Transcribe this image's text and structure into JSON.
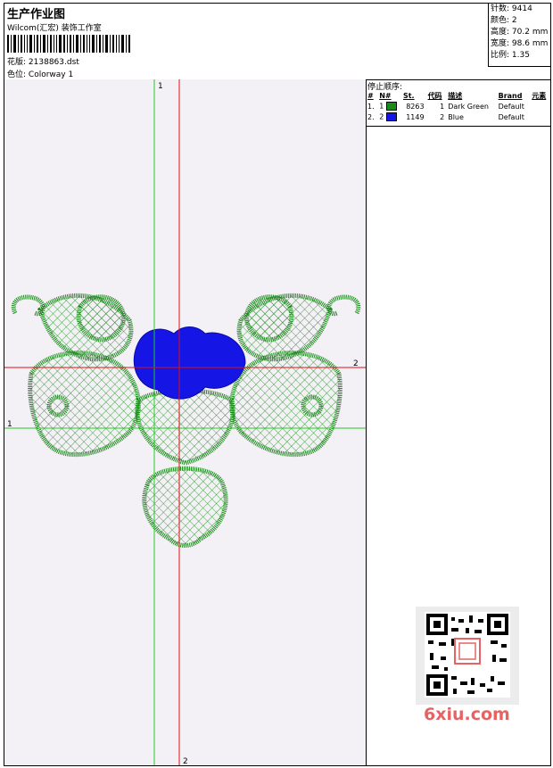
{
  "header": {
    "title": "生产作业图",
    "company": "Wilcom(汇宏) 装饰工作室",
    "pattern_label": "花版:",
    "pattern_value": "2138863.dst",
    "colorway_label": "色位:",
    "colorway_value": "Colorway 1"
  },
  "stats": {
    "stitches_label": "针数:",
    "stitches_value": "9414",
    "colors_label": "颜色:",
    "colors_value": "2",
    "height_label": "高度:",
    "height_value": "70.2 mm",
    "width_label": "宽度:",
    "width_value": "98.6 mm",
    "scale_label": "比例:",
    "scale_value": "1.35"
  },
  "stop_sequence": {
    "title": "停止顺序:",
    "headers": [
      "#",
      "N#",
      "St.",
      "代码",
      "描述",
      "Brand",
      "元素"
    ],
    "rows": [
      {
        "index": "1.",
        "n": "1",
        "color": "#1a8a1a",
        "stitches": "8263",
        "code": "1",
        "desc": "Dark Green",
        "brand": "Default"
      },
      {
        "index": "2.",
        "n": "2",
        "color": "#1515e6",
        "stitches": "1149",
        "code": "2",
        "desc": "Blue",
        "brand": "Default"
      }
    ]
  },
  "axes": {
    "green_vertical_label": "1",
    "green_horizontal_label": "1",
    "red_horizontal_label": "2",
    "red_vertical_label": "2",
    "green_color": "#22cc22",
    "red_color": "#e01010"
  },
  "design_colors": {
    "green": "#1a8a1a",
    "blue": "#1515e6"
  },
  "watermark": {
    "text": "6xiu.com",
    "color": "#e76363"
  }
}
